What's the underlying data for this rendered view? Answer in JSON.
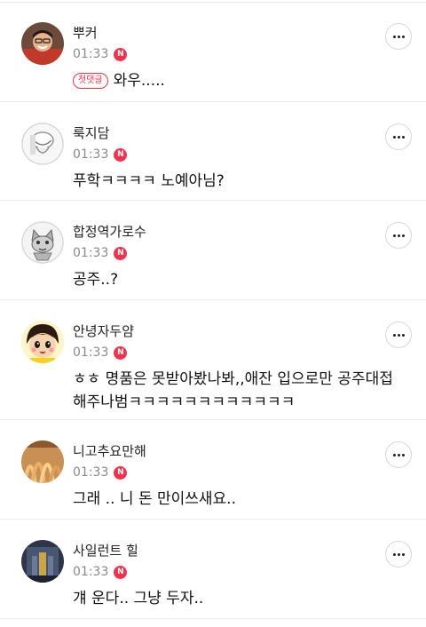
{
  "comments": [
    {
      "author": "뿌커",
      "time": "01:33",
      "new_badge": "N",
      "first_badge": "첫댓글",
      "text": "와우.....",
      "avatar_icon": "avatar-photo-man-icon"
    },
    {
      "author": "룩지담",
      "time": "01:33",
      "new_badge": "N",
      "text": "푸학ㅋㅋㅋㅋ 노예아님?",
      "avatar_icon": "avatar-sketch-face-icon"
    },
    {
      "author": "합정역가로수",
      "time": "01:33",
      "new_badge": "N",
      "text": "공주..?",
      "avatar_icon": "avatar-cartoon-cat-icon"
    },
    {
      "author": "안녕자두얌",
      "time": "01:33",
      "new_badge": "N",
      "text": "ㅎㅎ 명품은 못받아봤나봐,,애잔 입으로만 공주대접 해주나범ㅋㅋㅋㅋㅋㅋㅋㅋㅋㅋㅋㅋ",
      "avatar_icon": "avatar-cartoon-girl-icon"
    },
    {
      "author": "니고추요만해",
      "time": "01:33",
      "new_badge": "N",
      "text": "그래 .. 니 돈 만이쓰새요..",
      "avatar_icon": "avatar-photo-noodles-icon"
    },
    {
      "author": "사일런트 힐",
      "time": "01:33",
      "new_badge": "N",
      "text": "걔 운다.. 그냥 두자..",
      "avatar_icon": "avatar-photo-dark-icon"
    }
  ],
  "colors": {
    "accent": "#f2334b",
    "time": "#8a8a8a",
    "divider": "#ececec"
  }
}
